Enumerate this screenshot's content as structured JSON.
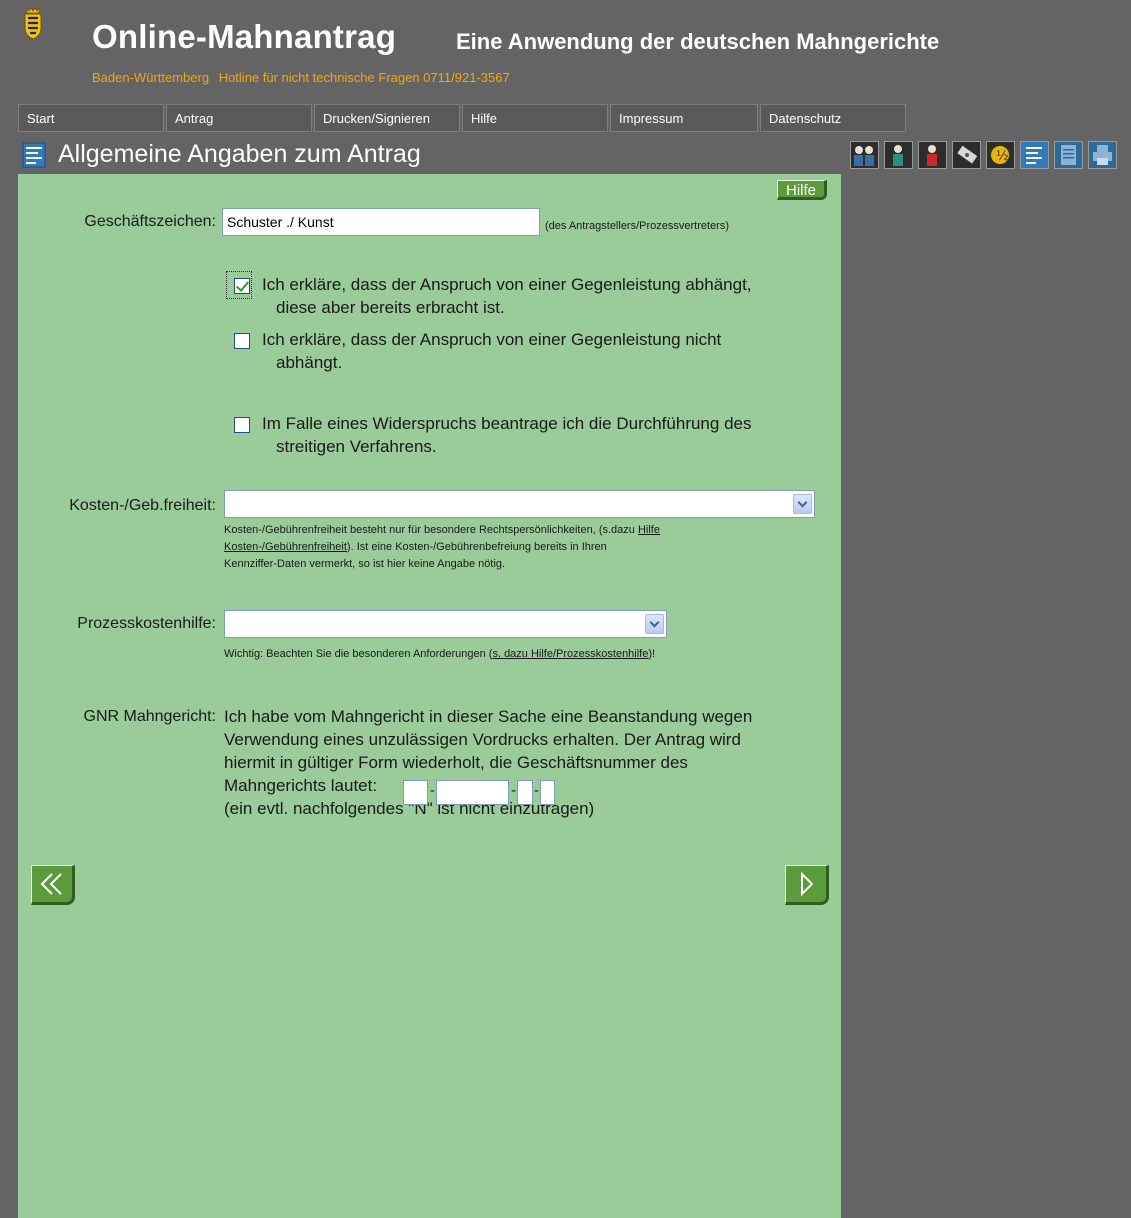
{
  "header": {
    "app_title": "Online-Mahnantrag",
    "app_subtitle": "Eine Anwendung der deutschen Mahngerichte",
    "state": "Baden-Württemberg",
    "hotline": "Hotline für nicht technische Fragen 0711/921-3567"
  },
  "nav": {
    "items": [
      {
        "label": "Start"
      },
      {
        "label": "Antrag"
      },
      {
        "label": "Drucken/Signieren"
      },
      {
        "label": "Hilfe"
      },
      {
        "label": "Impressum"
      },
      {
        "label": "Datenschutz"
      }
    ]
  },
  "section": {
    "title": "Allgemeine Angaben zum Antrag"
  },
  "toolbar_icons": [
    "parties-icon",
    "applicant-icon",
    "respondent-icon",
    "claim-icon",
    "costs-icon",
    "general-info-icon",
    "summary-icon",
    "print-icon"
  ],
  "form": {
    "help_label": "Hilfe",
    "geschaeftszeichen_label": "Geschäftszeichen:",
    "geschaeftszeichen_value": "Schuster ./ Kunst",
    "geschaeftszeichen_hint": "(des Antragstellers/Prozessvertreters)",
    "check1_line1": "Ich erkläre, dass der Anspruch von einer Gegenleistung abhängt,",
    "check1_line2": "diese aber bereits erbracht ist.",
    "check1_checked": true,
    "check2_line1": "Ich erkläre, dass der Anspruch von einer Gegenleistung nicht",
    "check2_line2": "abhängt.",
    "check2_checked": false,
    "check3_line1": "Im Falle eines Widerspruchs beantrage ich die Durchführung des",
    "check3_line2": "streitigen Verfahrens.",
    "check3_checked": false,
    "kosten_label": "Kosten-/Geb.freiheit:",
    "kosten_value": "",
    "kosten_note_line1a": "Kosten-/Gebührenfreiheit besteht nur für besondere Rechtspersönlichkeiten, (s.dazu ",
    "kosten_note_link_a": "Hilfe",
    "kosten_note_link_b": "Kosten-/Gebührenfreiheit",
    "kosten_note_line2b": "). Ist eine Kosten-/Gebührenbefreiung bereits in Ihren",
    "kosten_note_line3": "Kennziffer-Daten vermerkt, so ist hier keine Angabe nötig.",
    "pkh_label": "Prozesskostenhilfe:",
    "pkh_value": "",
    "pkh_note_pre": "Wichtig: Beachten Sie die besonderen Anforderungen (",
    "pkh_note_link": "s. dazu Hilfe/Prozesskostenhilfe",
    "pkh_note_post": ")!",
    "gnr_label": "GNR Mahngericht:",
    "gnr_line1": "Ich habe vom Mahngericht in dieser Sache eine Beanstandung wegen",
    "gnr_line2": "Verwendung eines unzulässigen Vordrucks erhalten. Der Antrag wird",
    "gnr_line3": "hiermit in gültiger Form wiederholt, die Geschäftsnummer des",
    "gnr_line4": "Mahngerichts lautet:",
    "gnr_line5": "(ein evtl. nachfolgendes \"N\" ist nicht einzutragen)",
    "dash": "-"
  }
}
